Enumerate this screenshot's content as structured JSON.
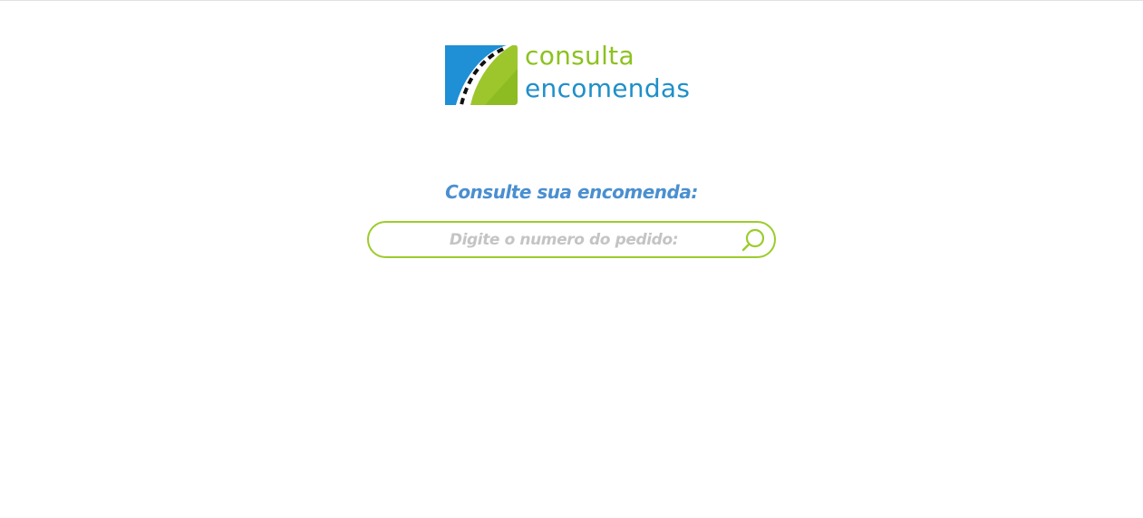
{
  "brand": {
    "line1": "consulta",
    "line2": "encomendas",
    "colors": {
      "green": "#8cc21f",
      "blue": "#1f8fc8"
    }
  },
  "heading": "Consulte sua encomenda:",
  "search": {
    "placeholder": "Digite o numero do pedido:",
    "value": "",
    "icon": "search-icon",
    "border_color": "#9ccc2b"
  },
  "accent": "#4a8fd0"
}
